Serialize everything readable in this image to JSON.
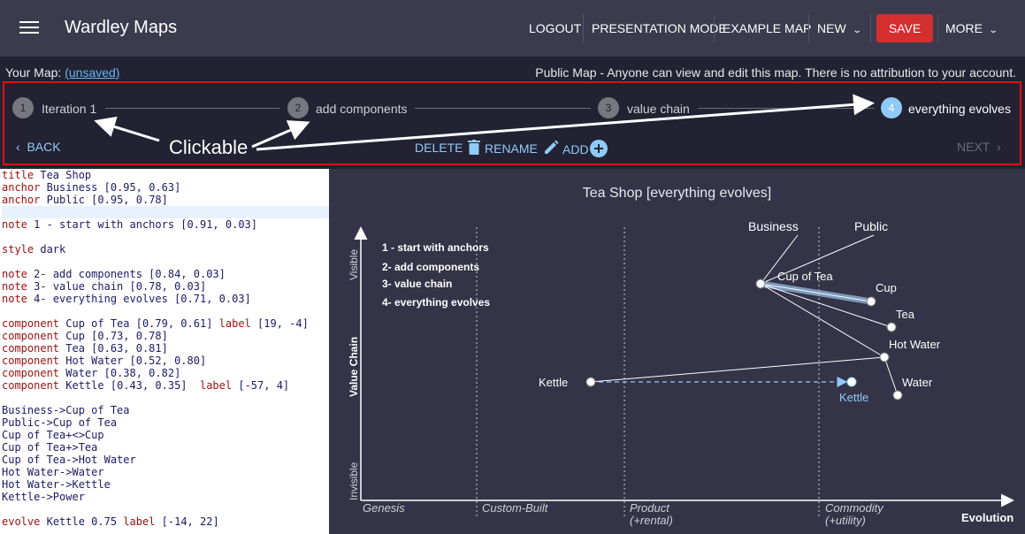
{
  "appbar": {
    "title": "Wardley Maps",
    "logout": "LOGOUT",
    "presentation": "PRESENTATION MODE",
    "example": "EXAMPLE MAP",
    "new": "NEW",
    "save": "SAVE",
    "more": "MORE",
    "save_color": "#d32f2f"
  },
  "infobar": {
    "your_map": "Your Map:",
    "unsaved": "(unsaved)",
    "public_note": "Public Map - Anyone can view and edit this map. There is no attribution to your account."
  },
  "stepper": {
    "steps": [
      {
        "num": "1",
        "label": "Iteration 1"
      },
      {
        "num": "2",
        "label": "add components"
      },
      {
        "num": "3",
        "label": "value chain"
      },
      {
        "num": "4",
        "label": "everything evolves"
      }
    ],
    "active_step": 4,
    "back": "BACK",
    "delete": "DELETE",
    "rename": "RENAME",
    "add": "ADD",
    "next": "NEXT",
    "annotation": "Clickable"
  },
  "editor": {
    "lines": [
      [
        [
          "kw",
          "title"
        ],
        [
          "",
          "Tea Shop"
        ]
      ],
      [
        [
          "kw",
          "anchor"
        ],
        [
          "",
          "Business [0.95, 0.63]"
        ]
      ],
      [
        [
          "kw",
          "anchor"
        ],
        [
          "",
          "Public [0.95, 0.78]"
        ]
      ],
      [],
      [
        [
          "kw",
          "note"
        ],
        [
          "",
          "1 - start with anchors [0.91, 0.03]"
        ]
      ],
      [],
      [
        [
          "kw",
          "style"
        ],
        [
          "",
          "dark"
        ]
      ],
      [],
      [
        [
          "kw",
          "note"
        ],
        [
          "",
          "2- add components [0.84, 0.03]"
        ]
      ],
      [
        [
          "kw",
          "note"
        ],
        [
          "",
          "3- value chain [0.78, 0.03]"
        ]
      ],
      [
        [
          "kw",
          "note"
        ],
        [
          "",
          "4- everything evolves [0.71, 0.03]"
        ]
      ],
      [],
      [
        [
          "kw",
          "component"
        ],
        [
          "",
          "Cup of Tea [0.79, 0.61] "
        ],
        [
          "kw",
          "label"
        ],
        [
          "",
          "[19, -4]"
        ]
      ],
      [
        [
          "kw",
          "component"
        ],
        [
          "",
          "Cup [0.73, 0.78]"
        ]
      ],
      [
        [
          "kw",
          "component"
        ],
        [
          "",
          "Tea [0.63, 0.81]"
        ]
      ],
      [
        [
          "kw",
          "component"
        ],
        [
          "",
          "Hot Water [0.52, 0.80]"
        ]
      ],
      [
        [
          "kw",
          "component"
        ],
        [
          "",
          "Water [0.38, 0.82]"
        ]
      ],
      [
        [
          "kw",
          "component"
        ],
        [
          "",
          "Kettle [0.43, 0.35]  "
        ],
        [
          "kw",
          "label"
        ],
        [
          "",
          "[-57, 4]"
        ]
      ],
      [],
      [
        [
          "",
          "Business->Cup of Tea"
        ]
      ],
      [
        [
          "",
          "Public->Cup of Tea"
        ]
      ],
      [
        [
          "",
          "Cup of Tea+<>Cup"
        ]
      ],
      [
        [
          "",
          "Cup of Tea+>Tea"
        ]
      ],
      [
        [
          "",
          "Cup of Tea->Hot Water"
        ]
      ],
      [
        [
          "",
          "Hot Water->Water"
        ]
      ],
      [
        [
          "",
          "Hot Water->Kettle"
        ]
      ],
      [
        [
          "",
          "Kettle->Power"
        ]
      ],
      [],
      [
        [
          "kw",
          "evolve"
        ],
        [
          "",
          "Kettle 0.75 "
        ],
        [
          "kw",
          "label"
        ],
        [
          "",
          "[-14, 22]"
        ]
      ]
    ],
    "highlight_line": 3
  },
  "map": {
    "title": "Tea Shop [everything evolves]",
    "axis_y_label": "Value Chain",
    "axis_y_top": "Visible",
    "axis_y_bottom": "Invisible",
    "axis_x_label": "Evolution",
    "stages": [
      "Genesis",
      "Custom-Built",
      "Product",
      "(+rental)",
      "Commodity",
      "(+utility)"
    ],
    "notes": [
      "1 - start with anchors",
      "2- add components",
      "3- value chain",
      "4- everything evolves"
    ],
    "anchors": [
      "Business",
      "Public"
    ],
    "components": [
      "Cup of Tea",
      "Cup",
      "Tea",
      "Hot Water",
      "Water",
      "Kettle"
    ],
    "evolved_label": "Kettle",
    "evolve_color": "#90caf9"
  }
}
